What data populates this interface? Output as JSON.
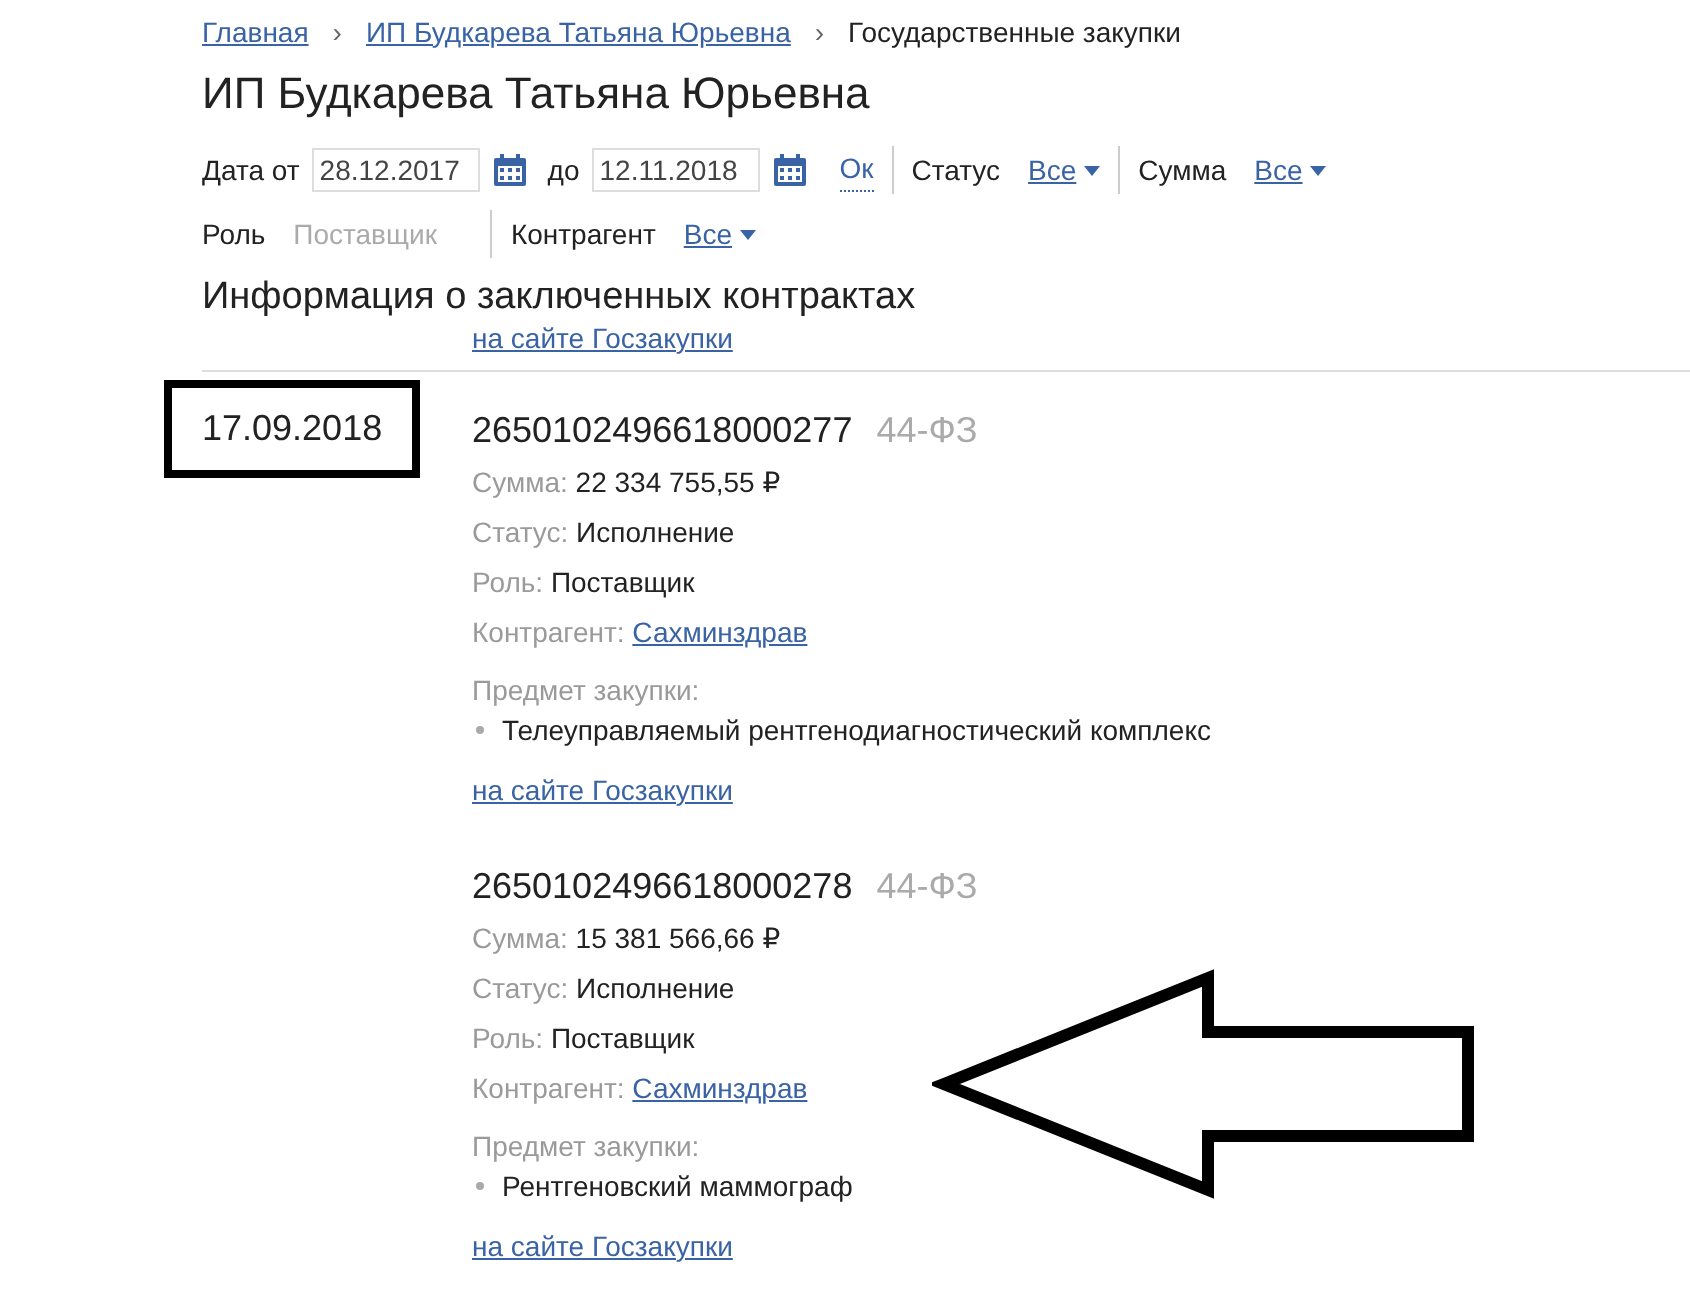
{
  "breadcrumbs": [
    {
      "label": "Главная",
      "kind": "link",
      "separator": "›"
    },
    {
      "label": "ИП Будкарева Татьяна Юрьевна",
      "kind": "link",
      "separator": "›"
    },
    {
      "label": "Государственные закупки",
      "kind": "current"
    }
  ],
  "title": "ИП Будкарева Татьяна Юрьевна",
  "filter_rows": [
    [
      {
        "items": [
          {
            "kind": "label",
            "text": "Дата от"
          },
          {
            "kind": "date",
            "value": "28.12.2017"
          },
          {
            "kind": "label",
            "text": "до"
          },
          {
            "kind": "date",
            "value": "12.11.2018"
          },
          {
            "kind": "apply",
            "text": "Ок"
          }
        ]
      },
      {
        "items": [
          {
            "kind": "label",
            "text": "Статус"
          },
          {
            "kind": "dropdown",
            "text": "Все"
          }
        ]
      },
      {
        "items": [
          {
            "kind": "label",
            "text": "Сумма"
          },
          {
            "kind": "dropdown",
            "text": "Все"
          }
        ]
      }
    ],
    [
      {
        "items": [
          {
            "kind": "label",
            "text": "Роль"
          },
          {
            "kind": "static",
            "text": "Поставщик"
          }
        ]
      },
      {
        "items": [
          {
            "kind": "label",
            "text": "Контрагент"
          },
          {
            "kind": "dropdown",
            "text": "Все"
          }
        ]
      }
    ]
  ],
  "section_title": "Информация о заключенных контрактах",
  "previous_link": "на сайте Госзакупки",
  "contracts": [
    {
      "date": "17.09.2018",
      "highlighted": true,
      "number": "2650102496618000277",
      "law": "44-ФЗ",
      "fields": [
        {
          "label": "Сумма:",
          "value": "22 334 755,55 ₽",
          "kind": "text"
        },
        {
          "label": "Статус:",
          "value": "Исполнение",
          "kind": "text"
        },
        {
          "label": "Роль:",
          "value": "Поставщик",
          "kind": "text"
        },
        {
          "label": "Контрагент:",
          "value": "Сахминздрав",
          "kind": "link"
        }
      ],
      "subject_label": "Предмет закупки:",
      "subject_items": [
        "Телеуправляемый рентгенодиагностический комплекс"
      ],
      "source_link": "на сайте Госзакупки"
    },
    {
      "number": "2650102496618000278",
      "law": "44-ФЗ",
      "fields": [
        {
          "label": "Сумма:",
          "value": "15 381 566,66 ₽",
          "kind": "text"
        },
        {
          "label": "Статус:",
          "value": "Исполнение",
          "kind": "text"
        },
        {
          "label": "Роль:",
          "value": "Поставщик",
          "kind": "text"
        },
        {
          "label": "Контрагент:",
          "value": "Сахминздрав",
          "kind": "link"
        }
      ],
      "subject_label": "Предмет закупки:",
      "subject_items": [
        "Рентгеновский маммограф"
      ],
      "source_link": "на сайте Госзакупки"
    }
  ],
  "pointer_arrow": true
}
